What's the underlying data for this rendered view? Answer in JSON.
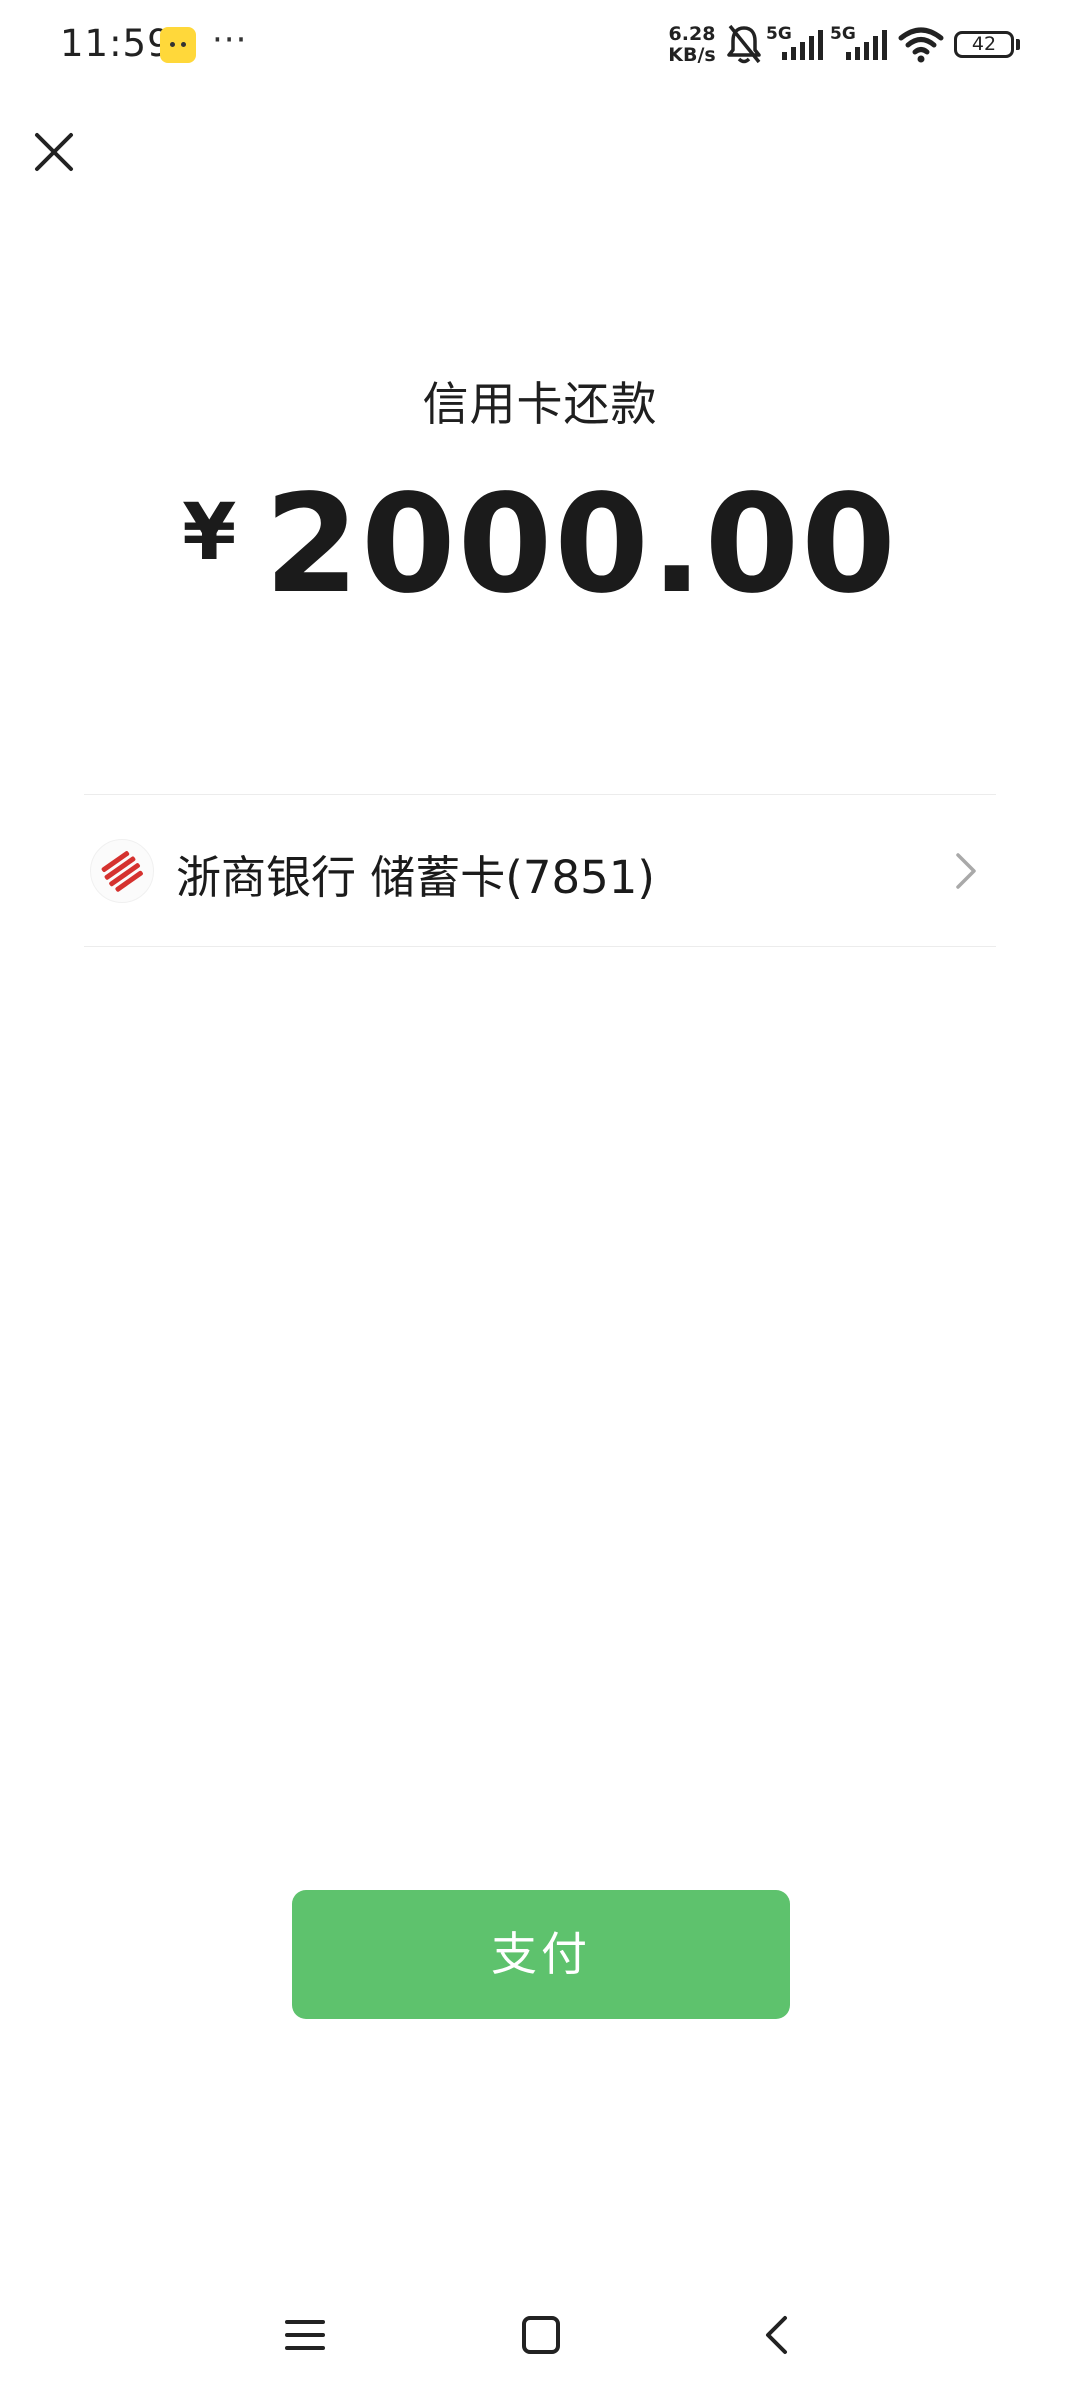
{
  "status_bar": {
    "time": "11:59",
    "more_indicator": "···",
    "net_speed_value": "6.28",
    "net_speed_unit": "KB/s",
    "sim1_label": "5G",
    "sim2_label": "5G",
    "battery_level": "42"
  },
  "header": {
    "title": "信用卡还款",
    "currency_symbol": "¥",
    "amount": "2000.00"
  },
  "payment_method": {
    "label": "浙商银行 储蓄卡(7851)",
    "logo_color": "#d5322f"
  },
  "actions": {
    "pay_label": "支付",
    "pay_color": "#5ec26d"
  },
  "icons": {
    "close": "close-icon",
    "chevron": "chevron-right-icon",
    "nav_menu": "menu-icon",
    "nav_home": "home-icon",
    "nav_back": "back-icon"
  }
}
